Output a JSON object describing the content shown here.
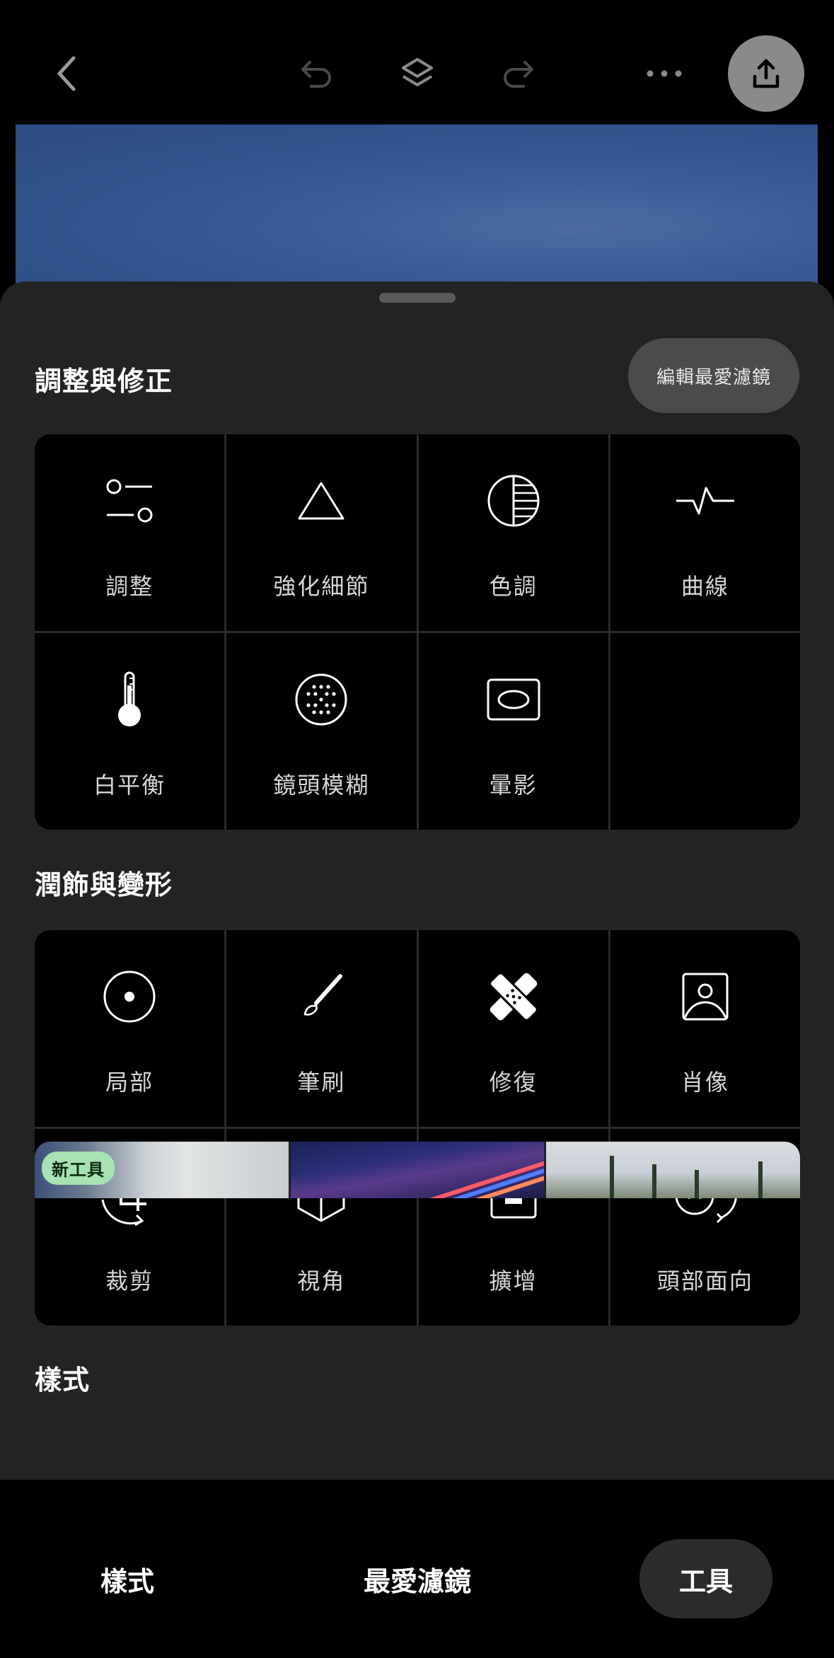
{
  "topbar": {
    "back_icon": "chevron-left-icon",
    "undo_icon": "undo-icon",
    "layers_icon": "layers-icon",
    "redo_icon": "redo-icon",
    "more_icon": "more-horizontal-icon",
    "export_icon": "upload-icon"
  },
  "sheet": {
    "section1": {
      "title": "調整與修正",
      "edit_button": "編輯最愛濾鏡",
      "tools": [
        {
          "label": "調整",
          "icon": "sliders-icon"
        },
        {
          "label": "強化細節",
          "icon": "triangle-icon"
        },
        {
          "label": "色調",
          "icon": "tonal-circle-icon"
        },
        {
          "label": "曲線",
          "icon": "curve-icon"
        },
        {
          "label": "白平衡",
          "icon": "thermometer-icon"
        },
        {
          "label": "鏡頭模糊",
          "icon": "dotted-circle-icon"
        },
        {
          "label": "暈影",
          "icon": "vignette-icon"
        }
      ]
    },
    "section2": {
      "title": "潤飾與變形",
      "tools": [
        {
          "label": "局部",
          "icon": "target-icon"
        },
        {
          "label": "筆刷",
          "icon": "brush-icon"
        },
        {
          "label": "修復",
          "icon": "bandage-icon"
        },
        {
          "label": "肖像",
          "icon": "portrait-icon"
        },
        {
          "label": "裁剪",
          "icon": "crop-rotate-icon"
        },
        {
          "label": "視角",
          "icon": "cube-icon"
        },
        {
          "label": "擴增",
          "icon": "expand-icon"
        },
        {
          "label": "頭部面向",
          "icon": "face-rotate-icon"
        }
      ]
    },
    "section3": {
      "title": "樣式",
      "badge": "新工具"
    }
  },
  "bottom_tabs": {
    "styles": "樣式",
    "favorites": "最愛濾鏡",
    "tools": "工具",
    "active": "tools"
  },
  "colors": {
    "sheet_bg": "#232325",
    "tile_bg": "#000000",
    "export_button": "#8a8a8a",
    "badge_bg": "#a7e2b2"
  }
}
